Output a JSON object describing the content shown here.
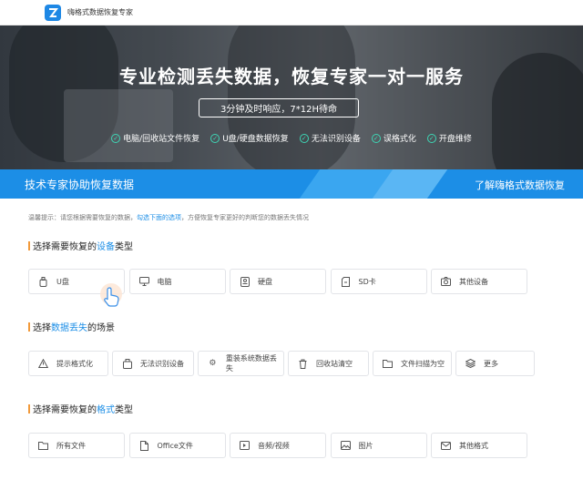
{
  "app": {
    "title": "嗨格式数据恢复专家"
  },
  "hero": {
    "title": "专业检测丢失数据，恢复专家一对一服务",
    "badge": "3分钟及时响应，7*12H待命",
    "features": [
      "电脑/回收站文件恢复",
      "U盘/硬盘数据恢复",
      "无法识别设备",
      "误格式化",
      "开盘维修"
    ]
  },
  "banner": {
    "left": "技术专家协助恢复数据",
    "right": "了解嗨格式数据恢复"
  },
  "tip": {
    "prefix": "温馨提示：请您根据需要恢复的数据，",
    "highlight": "勾选下面的选项",
    "suffix": "，方便恢复专家更好的判断您的数据丢失情况"
  },
  "sections": [
    {
      "pre": "选择需要恢复的",
      "hl": "设备",
      "post": "类型",
      "options": [
        {
          "label": "U盘",
          "icon": "usb-drive-icon"
        },
        {
          "label": "电脑",
          "icon": "monitor-icon"
        },
        {
          "label": "硬盘",
          "icon": "hard-drive-icon"
        },
        {
          "label": "SD卡",
          "icon": "sd-card-icon"
        },
        {
          "label": "其他设备",
          "icon": "camera-icon"
        }
      ]
    },
    {
      "pre": "选择",
      "hl": "数据丢失",
      "post": "的场景",
      "options": [
        {
          "label": "提示格式化",
          "icon": "warning-icon"
        },
        {
          "label": "无法识别设备",
          "icon": "device-icon"
        },
        {
          "label": "重装系统数据丢失",
          "icon": "gear-icon"
        },
        {
          "label": "回收站清空",
          "icon": "trash-icon"
        },
        {
          "label": "文件扫描为空",
          "icon": "folder-icon"
        },
        {
          "label": "更多",
          "icon": "layers-icon"
        }
      ]
    },
    {
      "pre": "选择需要恢复的",
      "hl": "格式",
      "post": "类型",
      "options": [
        {
          "label": "所有文件",
          "icon": "folder-icon"
        },
        {
          "label": "Office文件",
          "icon": "document-icon"
        },
        {
          "label": "音频/视频",
          "icon": "media-icon"
        },
        {
          "label": "图片",
          "icon": "image-icon"
        },
        {
          "label": "其他格式",
          "icon": "mail-icon"
        }
      ]
    }
  ]
}
